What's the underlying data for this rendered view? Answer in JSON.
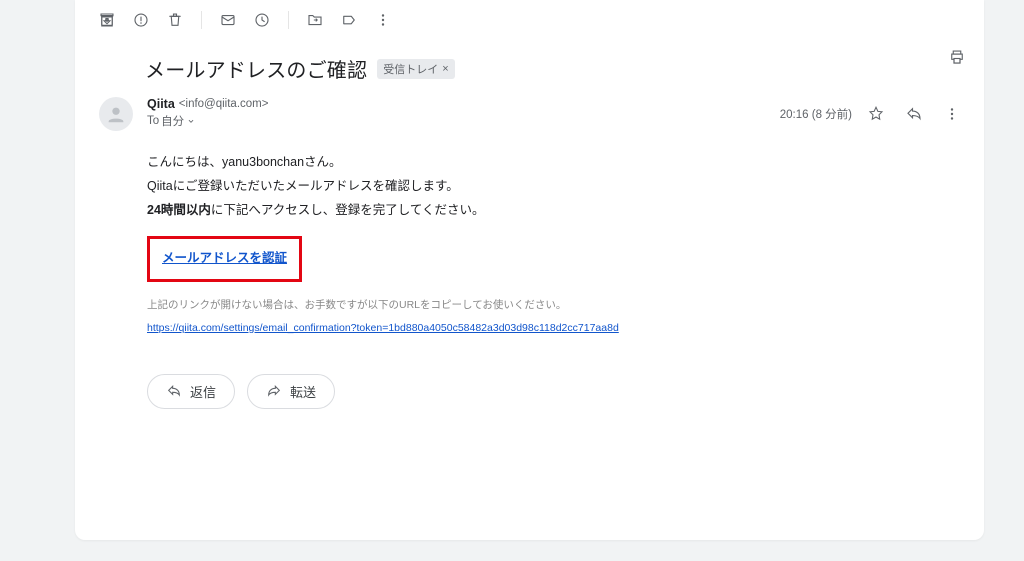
{
  "subject": "メールアドレスのご確認",
  "label_chip": "受信トレイ",
  "sender": {
    "name": "Qiita",
    "email": "<info@qiita.com>",
    "to_prefix": "To",
    "to_target": "自分"
  },
  "meta": {
    "time": "20:16 (8 分前)"
  },
  "body": {
    "line1_pre": "こんにちは、",
    "line1_user": "yanu3bonchan",
    "line1_post": "さん。",
    "line2": "Qiitaにご登録いただいたメールアドレスを確認します。",
    "line3_bold": "24時間以内",
    "line3_rest": "に下記へアクセスし、登録を完了してください。",
    "verify_link_text": "メールアドレスを認証",
    "fallback_note": "上記のリンクが開けない場合は、お手数ですが以下のURLをコピーしてお使いください。",
    "fallback_url": "https://qiita.com/settings/email_confirmation?token=1bd880a4050c58482a3d03d98c118d2cc717aa8d"
  },
  "actions": {
    "reply": "返信",
    "forward": "転送"
  },
  "icons": {
    "archive": "archive-icon",
    "spam": "spam-icon",
    "delete": "delete-icon",
    "unread": "unread-icon",
    "snooze": "snooze-icon",
    "moveto": "moveto-icon",
    "label": "label-icon",
    "more": "more-icon",
    "print": "print-icon",
    "star": "star-icon",
    "reply_ic": "reply-icon",
    "kebab": "kebab-icon"
  }
}
